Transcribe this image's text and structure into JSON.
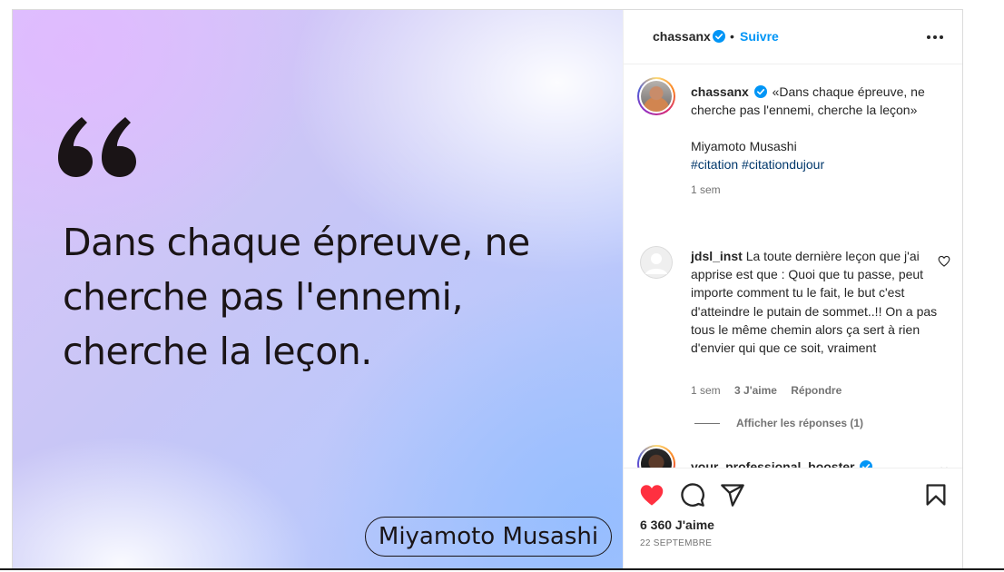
{
  "image": {
    "quote_text": "Dans chaque épreuve, ne cherche pas l'ennemi, cherche la leçon.",
    "author_label": "Miyamoto Musashi",
    "quote_icon": "quote-mark-icon"
  },
  "header": {
    "username": "chassanx",
    "separator": "•",
    "follow_label": "Suivre",
    "more_icon": "more-horizontal-icon"
  },
  "caption": {
    "username": "chassanx",
    "text": "«Dans chaque épreuve, ne cherche pas l'ennemi, cherche la leçon»",
    "author": "Miyamoto Musashi",
    "hashtags": [
      "#citation",
      "#citationdujour"
    ],
    "time": "1 sem"
  },
  "comments": [
    {
      "username": "jdsl_inst",
      "text": "La toute dernière leçon que j'ai apprise est que : Quoi que tu passe, peut importe comment tu le fait, le but c'est d'atteindre le putain de sommet..!! On a pas tous le même chemin alors ça sert à rien d'envier qui que ce soit, vraiment",
      "time": "1 sem",
      "likes": "3 J'aime",
      "reply_label": "Répondre",
      "view_replies": "Afficher les réponses (1)"
    },
    {
      "username": "your_professional_booster"
    }
  ],
  "actions": {
    "likes": "6 360 J'aime",
    "date": "22 SEPTEMBRE"
  },
  "colors": {
    "accent": "#0095f6",
    "like_red": "#ff3040",
    "hashtag": "#00376b",
    "secondary_text": "#737373"
  }
}
